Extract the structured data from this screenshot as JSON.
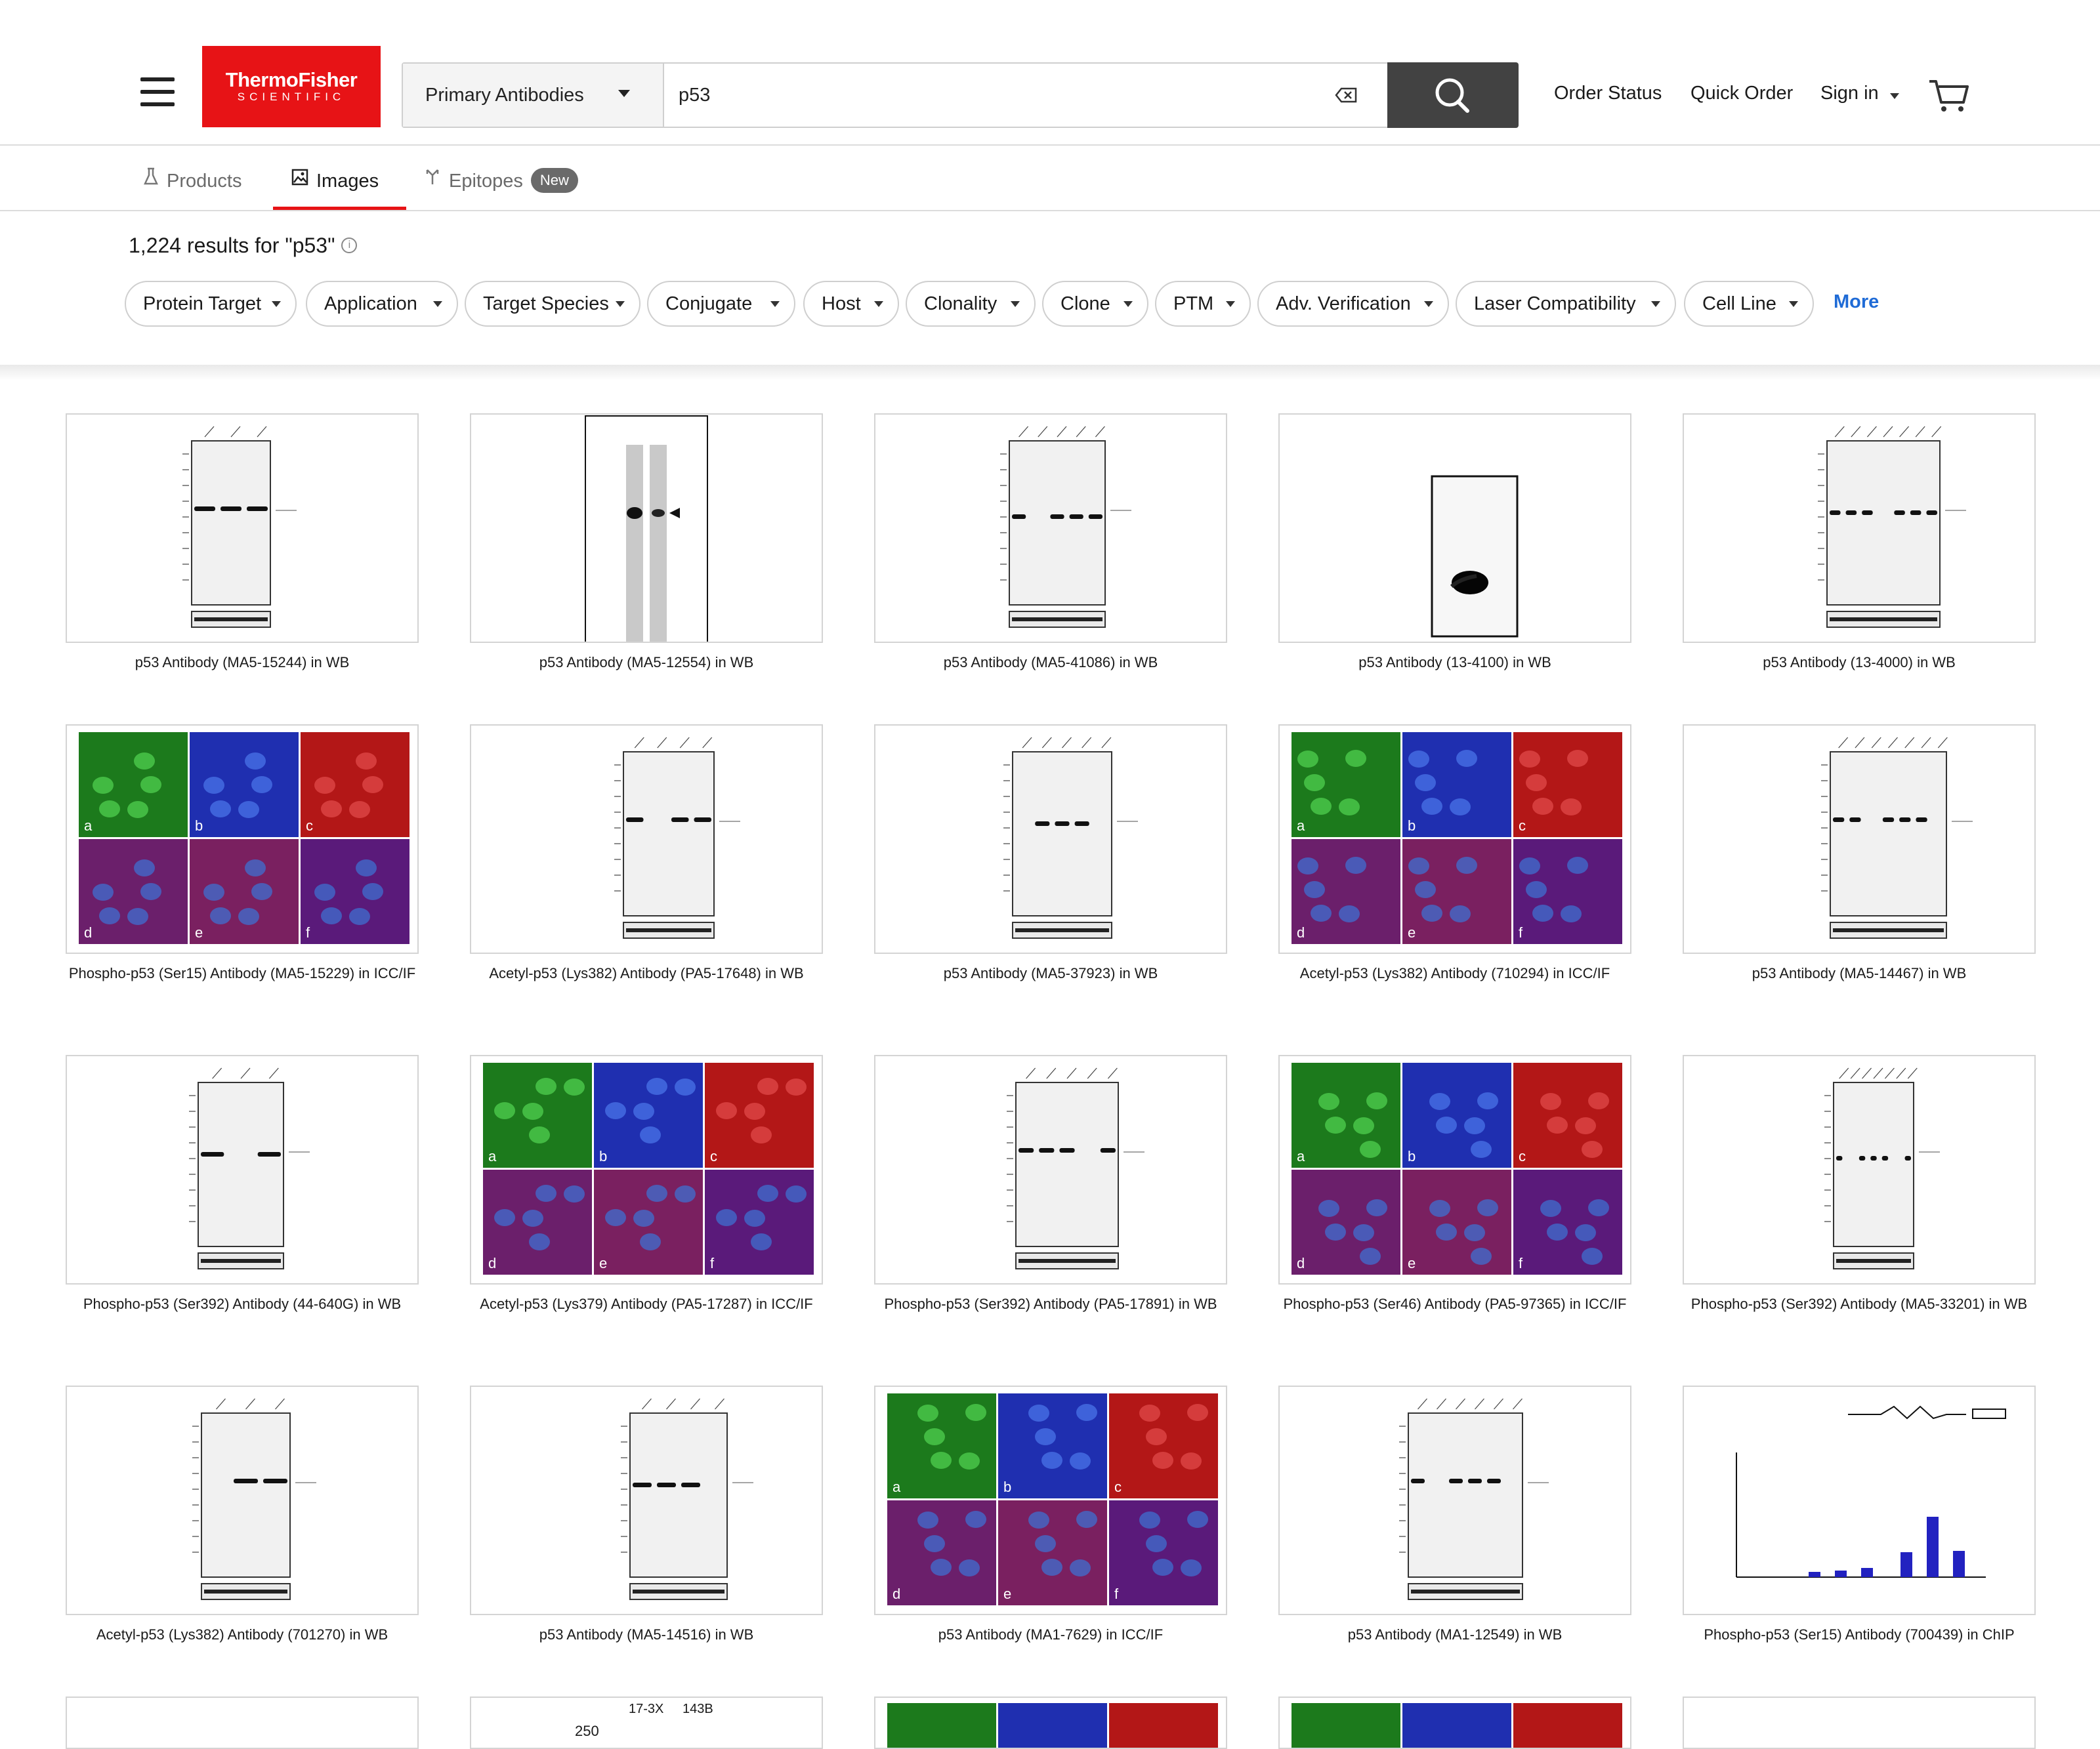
{
  "header": {
    "logo_line1": "ThermoFisher",
    "logo_line2": "SCIENTIFIC",
    "category": "Primary Antibodies",
    "search_value": "p53",
    "nav": [
      "Order Status",
      "Quick Order",
      "Sign in"
    ]
  },
  "tabs": [
    {
      "label": "Products",
      "icon": "flask-icon"
    },
    {
      "label": "Images",
      "icon": "image-icon"
    },
    {
      "label": "Epitopes",
      "icon": "epitope-icon",
      "badge": "New"
    }
  ],
  "results_text": "1,224 results for \"p53\"",
  "filters": [
    "Protein Target",
    "Application",
    "Target Species",
    "Conjugate",
    "Host",
    "Clonality",
    "Clone",
    "PTM",
    "Adv. Verification",
    "Laser Compatibility",
    "Cell Line"
  ],
  "more_label": "More",
  "cards": [
    {
      "caption": "p53 Antibody (MA5-15244) in WB",
      "kind": "wb"
    },
    {
      "caption": "p53 Antibody (MA5-12554) in WB",
      "kind": "wb2"
    },
    {
      "caption": "p53 Antibody (MA5-41086) in WB",
      "kind": "wb"
    },
    {
      "caption": "p53 Antibody (13-4100) in WB",
      "kind": "wb3"
    },
    {
      "caption": "p53 Antibody (13-4000) in WB",
      "kind": "wb"
    },
    {
      "caption": "Phospho-p53 (Ser15) Antibody (MA5-15229) in ICC/IF",
      "kind": "if"
    },
    {
      "caption": "Acetyl-p53 (Lys382) Antibody (PA5-17648) in WB",
      "kind": "wb"
    },
    {
      "caption": "p53 Antibody (MA5-37923) in WB",
      "kind": "wb"
    },
    {
      "caption": "Acetyl-p53 (Lys382) Antibody (710294) in ICC/IF",
      "kind": "if"
    },
    {
      "caption": "p53 Antibody (MA5-14467) in WB",
      "kind": "wb"
    },
    {
      "caption": "Phospho-p53 (Ser392) Antibody (44-640G) in WB",
      "kind": "wb"
    },
    {
      "caption": "Acetyl-p53 (Lys379) Antibody (PA5-17287) in ICC/IF",
      "kind": "if"
    },
    {
      "caption": "Phospho-p53 (Ser392) Antibody (PA5-17891) in WB",
      "kind": "wb"
    },
    {
      "caption": "Phospho-p53 (Ser46) Antibody (PA5-97365) in ICC/IF",
      "kind": "if"
    },
    {
      "caption": "Phospho-p53 (Ser392) Antibody (MA5-33201) in WB",
      "kind": "wb"
    },
    {
      "caption": "Acetyl-p53 (Lys382) Antibody (701270) in WB",
      "kind": "wb"
    },
    {
      "caption": "p53 Antibody (MA5-14516) in WB",
      "kind": "wb"
    },
    {
      "caption": "p53 Antibody (MA1-7629) in ICC/IF",
      "kind": "if"
    },
    {
      "caption": "p53 Antibody (MA1-12549) in WB",
      "kind": "wb"
    },
    {
      "caption": "Phospho-p53 (Ser15) Antibody (700439) in ChIP",
      "kind": "chip"
    }
  ],
  "partial_row_labels": [
    "17-3X",
    "143B",
    "250"
  ]
}
